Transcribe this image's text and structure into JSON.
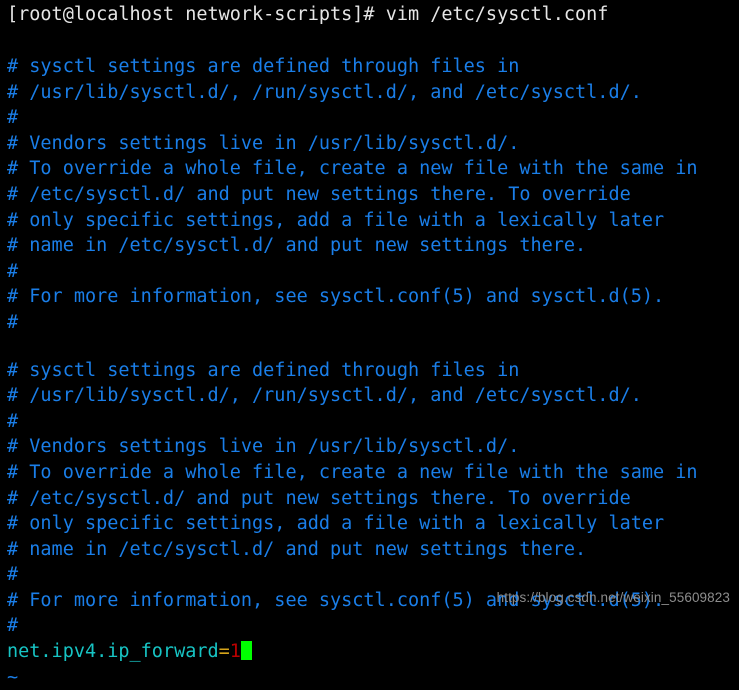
{
  "terminal": {
    "title": "vim /etc/sysctl.conf",
    "colors": {
      "background": "#000000",
      "prompt_text": "#e6e6e6",
      "comment": "#1a7ee8",
      "setting_key": "#17c4c4",
      "setting_operator": "#d6a41a",
      "setting_value": "#bb0000",
      "cursor": "#00ff00",
      "watermark": "#8d8d8d"
    },
    "prompt": {
      "full_text": "[root@localhost network-scripts]# vim /etc/sysctl.conf",
      "user_host": "[root@localhost network-scripts]#",
      "command": "vim /etc/sysctl.conf"
    },
    "block_one": [
      "# sysctl settings are defined through files in",
      "# /usr/lib/sysctl.d/, /run/sysctl.d/, and /etc/sysctl.d/.",
      "#",
      "# Vendors settings live in /usr/lib/sysctl.d/.",
      "# To override a whole file, create a new file with the same in",
      "# /etc/sysctl.d/ and put new settings there. To override",
      "# only specific settings, add a file with a lexically later",
      "# name in /etc/sysctl.d/ and put new settings there.",
      "#",
      "# For more information, see sysctl.conf(5) and sysctl.d(5).",
      "#"
    ],
    "block_two": [
      "# sysctl settings are defined through files in",
      "# /usr/lib/sysctl.d/, /run/sysctl.d/, and /etc/sysctl.d/.",
      "#",
      "# Vendors settings live in /usr/lib/sysctl.d/.",
      "# To override a whole file, create a new file with the same in",
      "# /etc/sysctl.d/ and put new settings there. To override",
      "# only specific settings, add a file with a lexically later",
      "# name in /etc/sysctl.d/ and put new settings there.",
      "#",
      "# For more information, see sysctl.conf(5) and sysctl.d(5).",
      "#"
    ],
    "setting_line": {
      "key": "net.ipv4.ip_forward",
      "operator": "=",
      "value": "1"
    },
    "empty_buffer_marker": "~",
    "watermark": "https://blog.csdn.net/weixin_55609823"
  }
}
